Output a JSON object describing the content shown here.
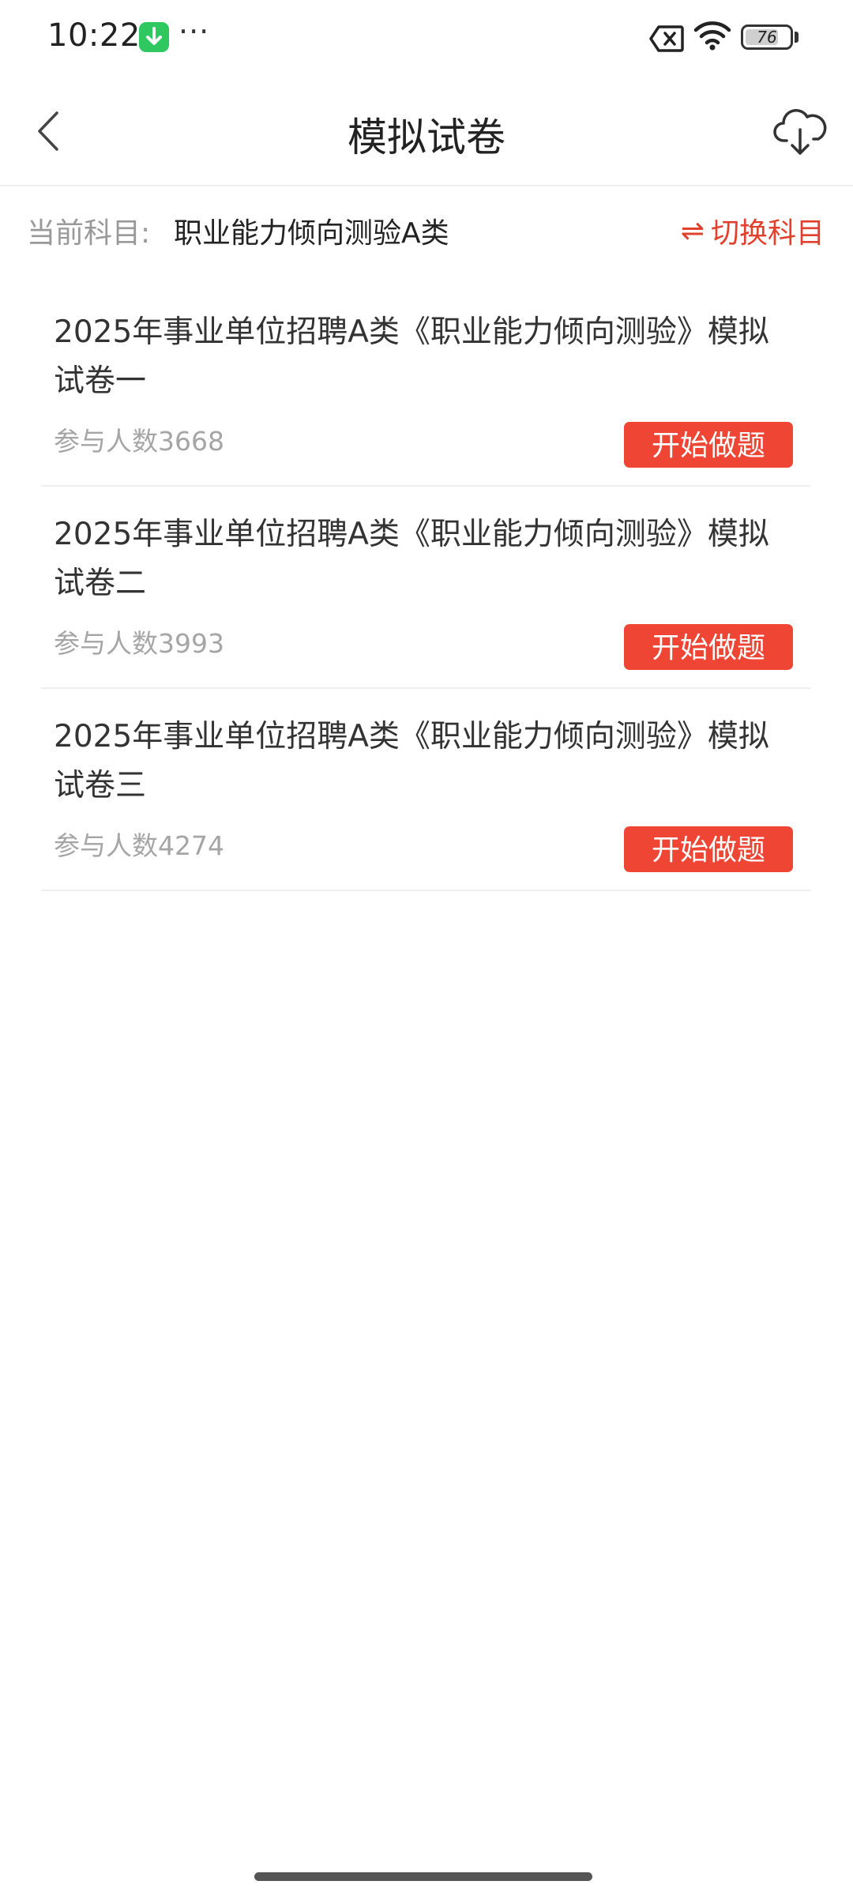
{
  "status_bar": {
    "time": "10:22",
    "download_icon": "download-arrow-icon",
    "more_dots": "···",
    "battery": "76",
    "battery_fraction": 0.76,
    "icons": [
      "sim-off-icon",
      "wifi-icon",
      "battery-icon"
    ]
  },
  "header": {
    "title": "模拟试卷",
    "back_icon": "chevron-left-icon",
    "download_icon": "cloud-download-icon"
  },
  "subject": {
    "label": "当前科目:",
    "value": "职业能力倾向测验A类",
    "switch_icon": "⇌",
    "switch_label": "切换科目",
    "accent_color": "#e0402c"
  },
  "papers": [
    {
      "title": "2025年事业单位招聘A类《职业能力倾向测验》模拟试卷一",
      "count": "参与人数3668",
      "button": "开始做题"
    },
    {
      "title": "2025年事业单位招聘A类《职业能力倾向测验》模拟试卷二",
      "count": "参与人数3993",
      "button": "开始做题"
    },
    {
      "title": "2025年事业单位招聘A类《职业能力倾向测验》模拟试卷三",
      "count": "参与人数4274",
      "button": "开始做题"
    }
  ],
  "colors": {
    "button_bg": "#ee4534",
    "secondary_text": "#a5a5a5"
  }
}
